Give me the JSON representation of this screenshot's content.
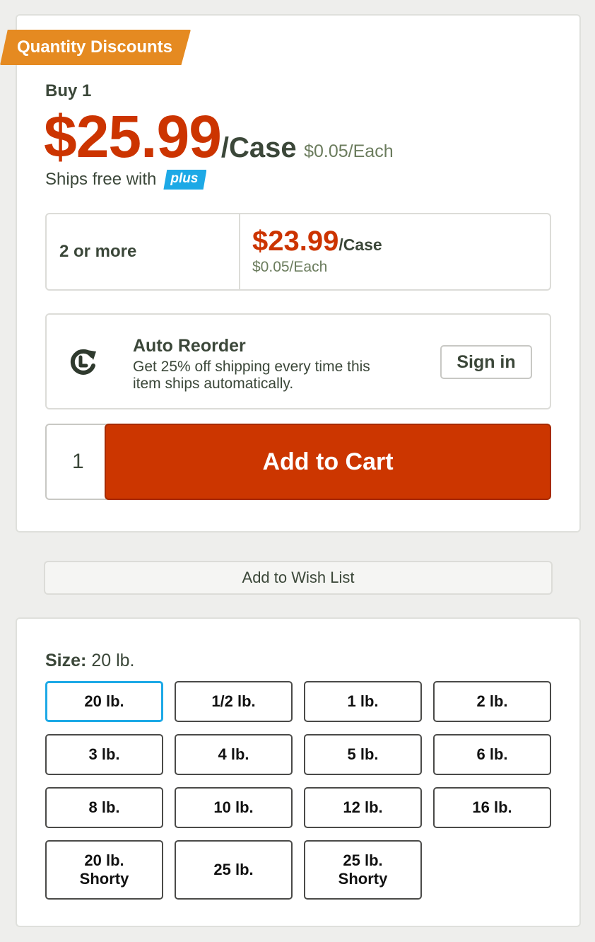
{
  "badge": {
    "label": "Quantity Discounts"
  },
  "pricing": {
    "buy_label": "Buy 1",
    "price": "$25.99",
    "unit": "/Case",
    "each": "$0.05/Each",
    "ships_text": "Ships free with",
    "plus_label": "plus"
  },
  "tier": {
    "qty_label": "2 or more",
    "price": "$23.99",
    "unit": "/Case",
    "each": "$0.05/Each"
  },
  "auto_reorder": {
    "title": "Auto Reorder",
    "description": "Get 25% off shipping every time this item ships automatically.",
    "signin_label": "Sign in"
  },
  "cart": {
    "quantity": "1",
    "add_label": "Add to Cart"
  },
  "wishlist": {
    "label": "Add to Wish List"
  },
  "size": {
    "label": "Size:",
    "selected": "20 lb.",
    "options": [
      "20 lb.",
      "1/2 lb.",
      "1 lb.",
      "2 lb.",
      "3 lb.",
      "4 lb.",
      "5 lb.",
      "6 lb.",
      "8 lb.",
      "10 lb.",
      "12 lb.",
      "16 lb.",
      "20 lb.\nShorty",
      "25 lb.",
      "25 lb.\nShorty"
    ]
  },
  "colors": {
    "price_red": "#cc3400",
    "cart_button": "#cc3600",
    "badge_orange": "#e58a21",
    "plus_blue": "#1da9e6",
    "selected_border": "#1da9e6"
  }
}
